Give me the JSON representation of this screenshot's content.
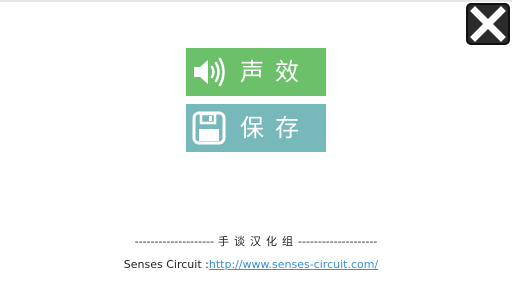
{
  "menu": {
    "sound": {
      "label": "声效",
      "icon": "speaker-icon",
      "color": "#6cc06a"
    },
    "save": {
      "label": "保存",
      "icon": "floppy-disk-icon",
      "color": "#77b8bb"
    }
  },
  "close": {
    "icon": "close-icon"
  },
  "credits": {
    "dashes_left": "--------------------",
    "group_name": "手谈汉化组",
    "dashes_right": "--------------------",
    "site_prefix": "Senses Circuit :",
    "site_url": "http://www.senses-circuit.com/"
  }
}
